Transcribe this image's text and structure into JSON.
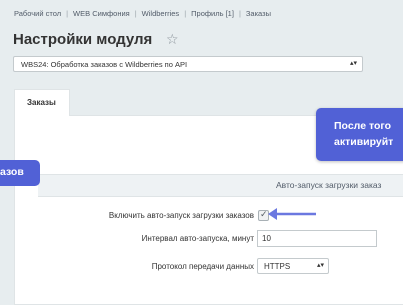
{
  "breadcrumb": [
    "Рабочий стол",
    "WEB Симфония",
    "Wildberries",
    "Профиль [1]",
    "Заказы"
  ],
  "page_title": "Настройки модуля",
  "module_select": {
    "value": "WBS24: Обработка заказов с Wildberries по API"
  },
  "tabs": [
    {
      "label": "Заказы"
    }
  ],
  "section": {
    "title": "Авто-запуск загрузки заказ"
  },
  "fields": {
    "autostart": {
      "label": "Включить авто-запуск загрузки заказов",
      "checked": true
    },
    "interval": {
      "label": "Интервал авто-запуска, минут",
      "value": "10"
    },
    "protocol": {
      "label": "Протокол передачи данных",
      "value": "HTTPS"
    }
  },
  "callouts": {
    "left": "азов",
    "right_line1": "После того",
    "right_line2": "активируйт"
  },
  "colors": {
    "callout": "#5161d6",
    "arrow": "#6b78e0"
  }
}
